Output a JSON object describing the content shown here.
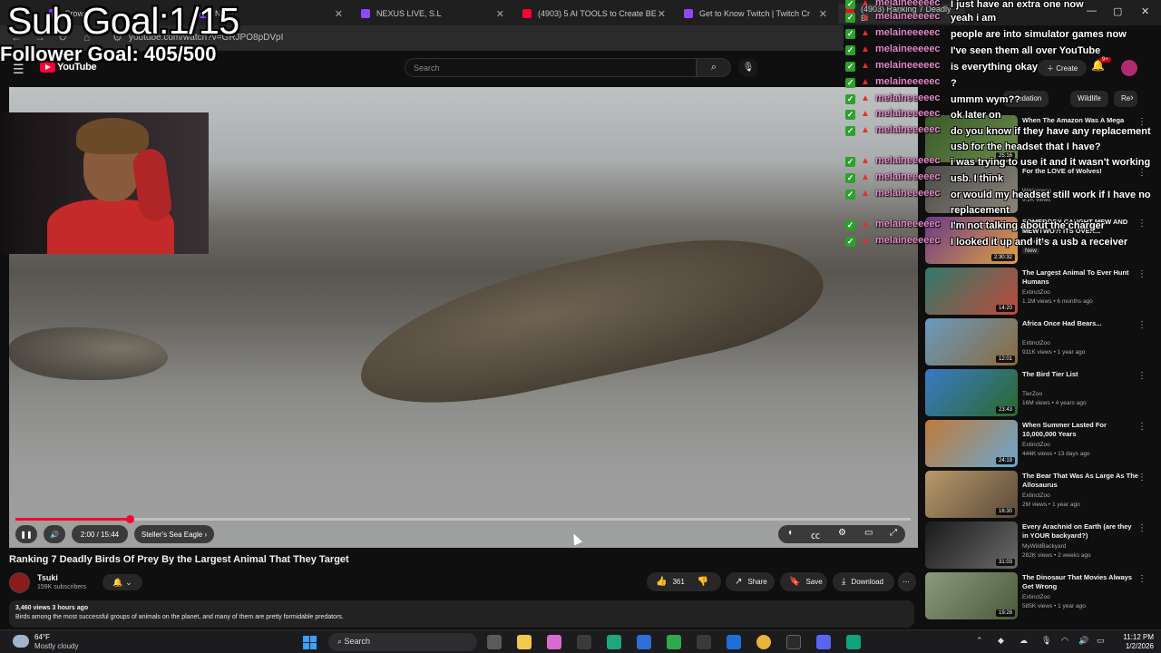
{
  "browser": {
    "tabs": [
      {
        "label": "Crow",
        "color": "#9146ff"
      },
      {
        "label": "Ne",
        "color": "#9146ff"
      },
      {
        "label": "NEXUS LIVE, S.L",
        "color": "#9146ff"
      },
      {
        "label": "(4903) 5 AI TOOLS to Create BE",
        "color": "#ff0033"
      },
      {
        "label": "Get to Know Twitch | Twitch Cr",
        "color": "#9146ff"
      },
      {
        "label": "(4903) Ranking 7 Deadly Bi",
        "color": "#ff0033"
      }
    ],
    "url": "youtube.com/watch?v=GRJPO8pDVpI"
  },
  "overlay": {
    "sub_goal": "Sub Goal:1/15",
    "follower_goal": "Follower Goal: 405/500"
  },
  "youtube": {
    "logo_text": "YouTube",
    "search_placeholder": "Search",
    "create_label": "Create",
    "notif_count": "9+"
  },
  "player": {
    "time": "2:00 / 15:44",
    "chapter": "Steller's Sea Eagle",
    "progress": 0.128
  },
  "video": {
    "title": "Ranking 7 Deadly Birds Of Prey By the Largest Animal That They Target",
    "channel": "Tsuki",
    "subscribers": "159K subscribers",
    "likes": "361",
    "share": "Share",
    "save": "Save",
    "download": "Download",
    "views_time": "3,460 views  3 hours ago",
    "description": "Birds among the most successful groups of animals on the planet, and many of them are pretty formidable predators."
  },
  "chips": [
    "Predation",
    "Wildlife",
    "Re"
  ],
  "recommendations": [
    {
      "title": "When The Amazon Was A Mega",
      "channel": "",
      "meta": "",
      "duration": "25:16",
      "colors": [
        "#3a5a2a",
        "#6b8a4a"
      ]
    },
    {
      "title": "For the LOVE of Wolves!",
      "channel": "Wilderness",
      "meta": "9.2K views",
      "duration": "",
      "colors": [
        "#4a4a48",
        "#8a857a"
      ]
    },
    {
      "title": "SOMEBODY CAUGHT MEW AND MEWTWO?! ITS OVER...",
      "channel": "",
      "meta": "1 hour ago",
      "badge": "New",
      "duration": "2:30:32",
      "colors": [
        "#6a3a8a",
        "#e0a040"
      ]
    },
    {
      "title": "The Largest Animal To Ever Hunt Humans",
      "channel": "ExtinctZoo",
      "meta": "1.1M views • 6 months ago",
      "duration": "14:20",
      "colors": [
        "#2f7a6a",
        "#c04a3a"
      ]
    },
    {
      "title": "Africa Once Had Bears...",
      "channel": "ExtinctZoo",
      "meta": "911K views • 1 year ago",
      "duration": "12:01",
      "colors": [
        "#6a9ac0",
        "#8a6a3a"
      ]
    },
    {
      "title": "The Bird Tier List",
      "channel": "TierZoo",
      "meta": "16M views • 4 years ago",
      "duration": "23:43",
      "colors": [
        "#3a7ac8",
        "#2a6a2a"
      ]
    },
    {
      "title": "When Summer Lasted For 10,000,000 Years",
      "channel": "ExtinctZoo",
      "meta": "444K views • 13 days ago",
      "duration": "24:19",
      "colors": [
        "#c07a3a",
        "#6aa8d0"
      ]
    },
    {
      "title": "The Bear That Was As Large As The Allosaurus",
      "channel": "ExtinctZoo",
      "meta": "2M views • 1 year ago",
      "duration": "16:30",
      "colors": [
        "#b89a6a",
        "#5a4a3a"
      ]
    },
    {
      "title": "Every Arachnid on Earth (are they in YOUR backyard?)",
      "channel": "MyWildBackyard",
      "meta": "282K views • 2 weeks ago",
      "duration": "31:03",
      "colors": [
        "#1a1a1a",
        "#6a6a6a"
      ]
    },
    {
      "title": "The Dinosaur That Movies Always Get Wrong",
      "channel": "ExtinctZoo",
      "meta": "585K views • 1 year ago",
      "duration": "19:28",
      "colors": [
        "#8a9a7a",
        "#4a5a3a"
      ]
    }
  ],
  "chat": [
    {
      "user": "melaineeeeec",
      "msg": "I just have an extra one now"
    },
    {
      "user": "melaineeeeec",
      "msg": "yeah i am"
    },
    {
      "user": "melaineeeeec",
      "msg": "people are into simulator games now"
    },
    {
      "user": "melaineeeeec",
      "msg": "I've seen them all over YouTube"
    },
    {
      "user": "melaineeeeec",
      "msg": "is everything okay"
    },
    {
      "user": "melaineeeeec",
      "msg": "?"
    },
    {
      "user": "melaineeeeec",
      "msg": "ummm wym??"
    },
    {
      "user": "melaineeeeec",
      "msg": "ok later on"
    },
    {
      "user": "melaineeeeec",
      "msg": "do you know if they have any replacement usb for the headset that I have?"
    },
    {
      "user": "melaineeeeec",
      "msg": "i was trying to use it and it wasn't working"
    },
    {
      "user": "melaineeeeec",
      "msg": "usb. I think"
    },
    {
      "user": "melaineeeeec",
      "msg": "or would my headset still work if I have no replacement"
    },
    {
      "user": "melaineeeeec",
      "msg": "I'm not talking about the charger"
    },
    {
      "user": "melaineeeeec",
      "msg": "I looked it up and it's a usb a receiver"
    }
  ],
  "taskbar": {
    "temp": "64°F",
    "condition": "Mostly cloudy",
    "search": "Search",
    "time": "11:12 PM",
    "date": "1/2/2026"
  }
}
